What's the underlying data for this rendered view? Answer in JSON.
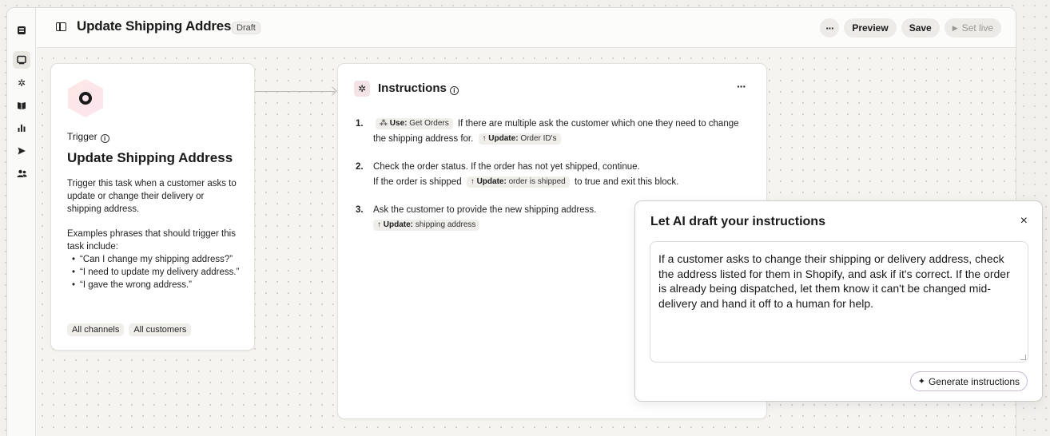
{
  "header": {
    "title": "Update Shipping Address",
    "status_badge": "Draft",
    "more_label": "···",
    "preview_label": "Preview",
    "save_label": "Save",
    "set_live_label": "Set live"
  },
  "sidebar": {
    "icons": [
      "inbox-icon",
      "monitor-icon",
      "sparkle-icon",
      "book-icon",
      "chart-icon",
      "send-icon",
      "users-icon"
    ]
  },
  "trigger": {
    "label": "Trigger",
    "title": "Update Shipping Address",
    "description": "Trigger this task when a customer asks to update or change their delivery or shipping address.",
    "examples_intro": "Examples phrases that should trigger this task include:",
    "examples": [
      "“Can I change my shipping address?”",
      "“I need to update my delivery address.”",
      "“I gave the wrong address.”"
    ],
    "chips": [
      "All channels",
      "All customers"
    ]
  },
  "instructions": {
    "title": "Instructions",
    "more_label": "···",
    "step1": {
      "num": "1.",
      "use_key": "Use:",
      "use_value": "Get Orders",
      "text_a": "If there are multiple ask the customer which one they need to change the shipping address for.",
      "update_key": "Update:",
      "update_value": "Order ID's"
    },
    "step2": {
      "num": "2.",
      "text_a": "Check the order status. If the order has not yet shipped, continue.",
      "text_b": "If the order is shipped",
      "update_key": "Update:",
      "update_value": "order is shipped",
      "text_c": "to true and exit this block."
    },
    "step3": {
      "num": "3.",
      "text_a": "Ask the customer to provide the new shipping address.",
      "update_key": "Update:",
      "update_value": "shipping address"
    }
  },
  "ai_draft": {
    "title": "Let AI draft your instructions",
    "close_label": "×",
    "prompt_text": "If a customer asks to change their shipping or delivery address, check the address listed for them in Shopify, and ask if it's correct. If the order is already being dispatched, let them know it can't be changed mid-delivery and hand it off to a human for help.",
    "generate_label": "Generate instructions"
  }
}
